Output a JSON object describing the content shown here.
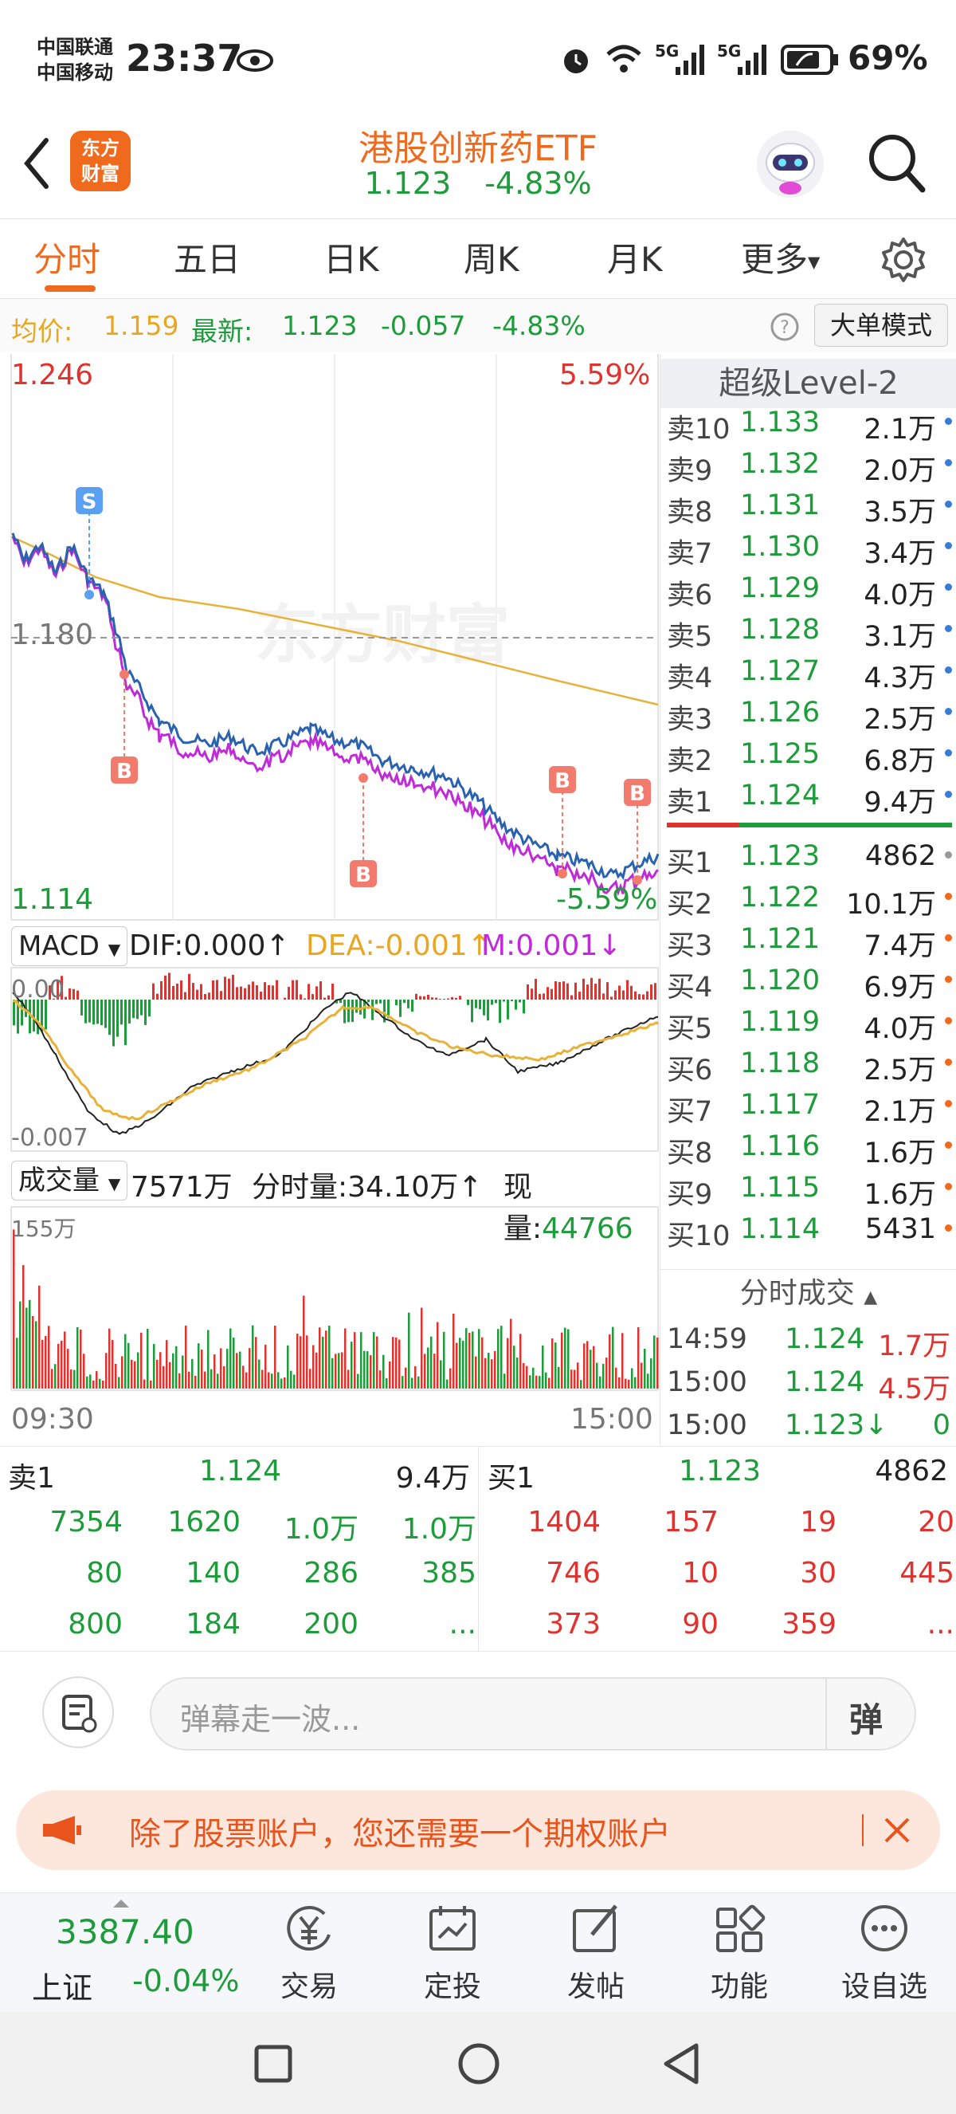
{
  "status_bar": {
    "carrier1": "中国联通",
    "carrier2": "中国移动",
    "time": "23:37",
    "battery": "69%",
    "net1": "5G",
    "net2": "5G"
  },
  "header": {
    "logo_line1": "东方",
    "logo_line2": "财富",
    "title": "港股创新药ETF",
    "price": "1.123",
    "change_pct": "-4.83%"
  },
  "tabs": [
    {
      "label": "分时",
      "active": true
    },
    {
      "label": "五日",
      "active": false
    },
    {
      "label": "日K",
      "active": false
    },
    {
      "label": "周K",
      "active": false
    },
    {
      "label": "月K",
      "active": false
    },
    {
      "label": "更多",
      "active": false
    }
  ],
  "info_line": {
    "avg_label": "均价:",
    "avg_value": "1.159",
    "latest_label": "最新:",
    "latest_value": "1.123",
    "change": "-0.057",
    "change_pct": "-4.83%",
    "mode_button": "大单模式"
  },
  "price_chart": {
    "ymax_label": "1.246",
    "ymax_pct": "5.59%",
    "mid_label": "1.180",
    "ymin_label": "1.114",
    "ymin_pct": "-5.59%",
    "watermark": "东方财富",
    "marker_s": "S",
    "marker_b": "B",
    "price_color": "#2a62b0",
    "avg_color": "#e8b23a",
    "other_color": "#c02bd8"
  },
  "macd": {
    "selector": "MACD",
    "dif": "DIF:0.000",
    "dea": "DEA:-0.001",
    "m": "M:0.001",
    "top_label": "0.00",
    "bottom_label": "-0.007"
  },
  "volume": {
    "selector": "成交量",
    "total": "7571万",
    "minute_vol_label": "分时量:34.10万",
    "current_label": "现量:",
    "current_value": "44766",
    "max_label": "155万",
    "time_start": "09:30",
    "time_end": "15:00"
  },
  "order_book": {
    "header": "超级Level-2",
    "asks": [
      {
        "label": "卖10",
        "price": "1.133",
        "vol": "2.1万"
      },
      {
        "label": "卖9",
        "price": "1.132",
        "vol": "2.0万"
      },
      {
        "label": "卖8",
        "price": "1.131",
        "vol": "3.5万"
      },
      {
        "label": "卖7",
        "price": "1.130",
        "vol": "3.4万"
      },
      {
        "label": "卖6",
        "price": "1.129",
        "vol": "4.0万"
      },
      {
        "label": "卖5",
        "price": "1.128",
        "vol": "3.1万"
      },
      {
        "label": "卖4",
        "price": "1.127",
        "vol": "4.3万"
      },
      {
        "label": "卖3",
        "price": "1.126",
        "vol": "2.5万"
      },
      {
        "label": "卖2",
        "price": "1.125",
        "vol": "6.8万"
      },
      {
        "label": "卖1",
        "price": "1.124",
        "vol": "9.4万"
      }
    ],
    "bids": [
      {
        "label": "买1",
        "price": "1.123",
        "vol": "4862"
      },
      {
        "label": "买2",
        "price": "1.122",
        "vol": "10.1万"
      },
      {
        "label": "买3",
        "price": "1.121",
        "vol": "7.4万"
      },
      {
        "label": "买4",
        "price": "1.120",
        "vol": "6.9万"
      },
      {
        "label": "买5",
        "price": "1.119",
        "vol": "4.0万"
      },
      {
        "label": "买6",
        "price": "1.118",
        "vol": "2.5万"
      },
      {
        "label": "买7",
        "price": "1.117",
        "vol": "2.1万"
      },
      {
        "label": "买8",
        "price": "1.116",
        "vol": "1.6万"
      },
      {
        "label": "买9",
        "price": "1.115",
        "vol": "1.6万"
      },
      {
        "label": "买10",
        "price": "1.114",
        "vol": "5431"
      }
    ],
    "trades_header": "分时成交",
    "trades": [
      {
        "time": "14:59",
        "price": "1.124",
        "vol": "1.7万"
      },
      {
        "time": "15:00",
        "price": "1.124",
        "vol": "4.5万"
      },
      {
        "time": "15:00",
        "price": "1.123↓",
        "vol": "0"
      }
    ]
  },
  "queue": {
    "sell_label": "卖1",
    "sell_price": "1.124",
    "sell_vol": "9.4万",
    "buy_label": "买1",
    "buy_price": "1.123",
    "buy_vol": "4862",
    "sell_rows": [
      [
        "7354",
        "1620",
        "1.0万",
        "1.0万"
      ],
      [
        "80",
        "140",
        "286",
        "385"
      ],
      [
        "800",
        "184",
        "200",
        "..."
      ]
    ],
    "buy_rows": [
      [
        "1404",
        "157",
        "19",
        "20"
      ],
      [
        "746",
        "10",
        "30",
        "445"
      ],
      [
        "373",
        "90",
        "359",
        "..."
      ]
    ]
  },
  "comment": {
    "placeholder": "弹幕走一波...",
    "danmu_button": "弹"
  },
  "banner": {
    "text": "除了股票账户，您还需要一个期权账户"
  },
  "bottom_nav": {
    "index_value": "3387.40",
    "index_name": "上证",
    "index_change": "-0.04%",
    "items": [
      "交易",
      "定投",
      "发帖",
      "功能",
      "设自选"
    ]
  }
}
